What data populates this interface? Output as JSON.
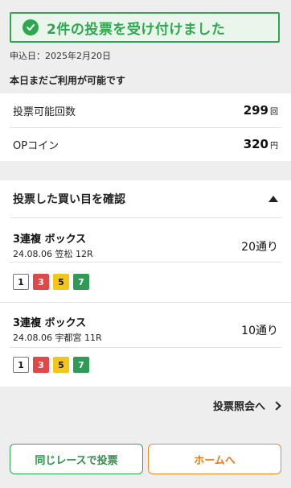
{
  "banner": {
    "message": "2件の投票を受け付けました"
  },
  "apply_date": "申込日：2025年2月20日",
  "availability_title": "本日まだご利用が可能です",
  "info": {
    "votes": {
      "label": "投票可能回数",
      "value": "299",
      "unit": "回"
    },
    "coins": {
      "label": "OPコイン",
      "value": "320",
      "unit": "円"
    }
  },
  "bets": {
    "title": "投票した買い目を確認",
    "items": [
      {
        "type": "3連複 ボックス",
        "race": "24.08.06 笠松 12R",
        "count": "20通り",
        "numbers": [
          "1",
          "3",
          "5",
          "7"
        ]
      },
      {
        "type": "3連複 ボックス",
        "race": "24.08.06 宇都宮 11R",
        "count": "10通り",
        "numbers": [
          "1",
          "3",
          "5",
          "7"
        ]
      }
    ]
  },
  "history_link": "投票照会へ",
  "buttons": {
    "same_race": "同じレースで投票",
    "home": "ホームへ"
  },
  "colors": {
    "accent_green": "#2ea84f",
    "accent_orange": "#f08a24"
  }
}
